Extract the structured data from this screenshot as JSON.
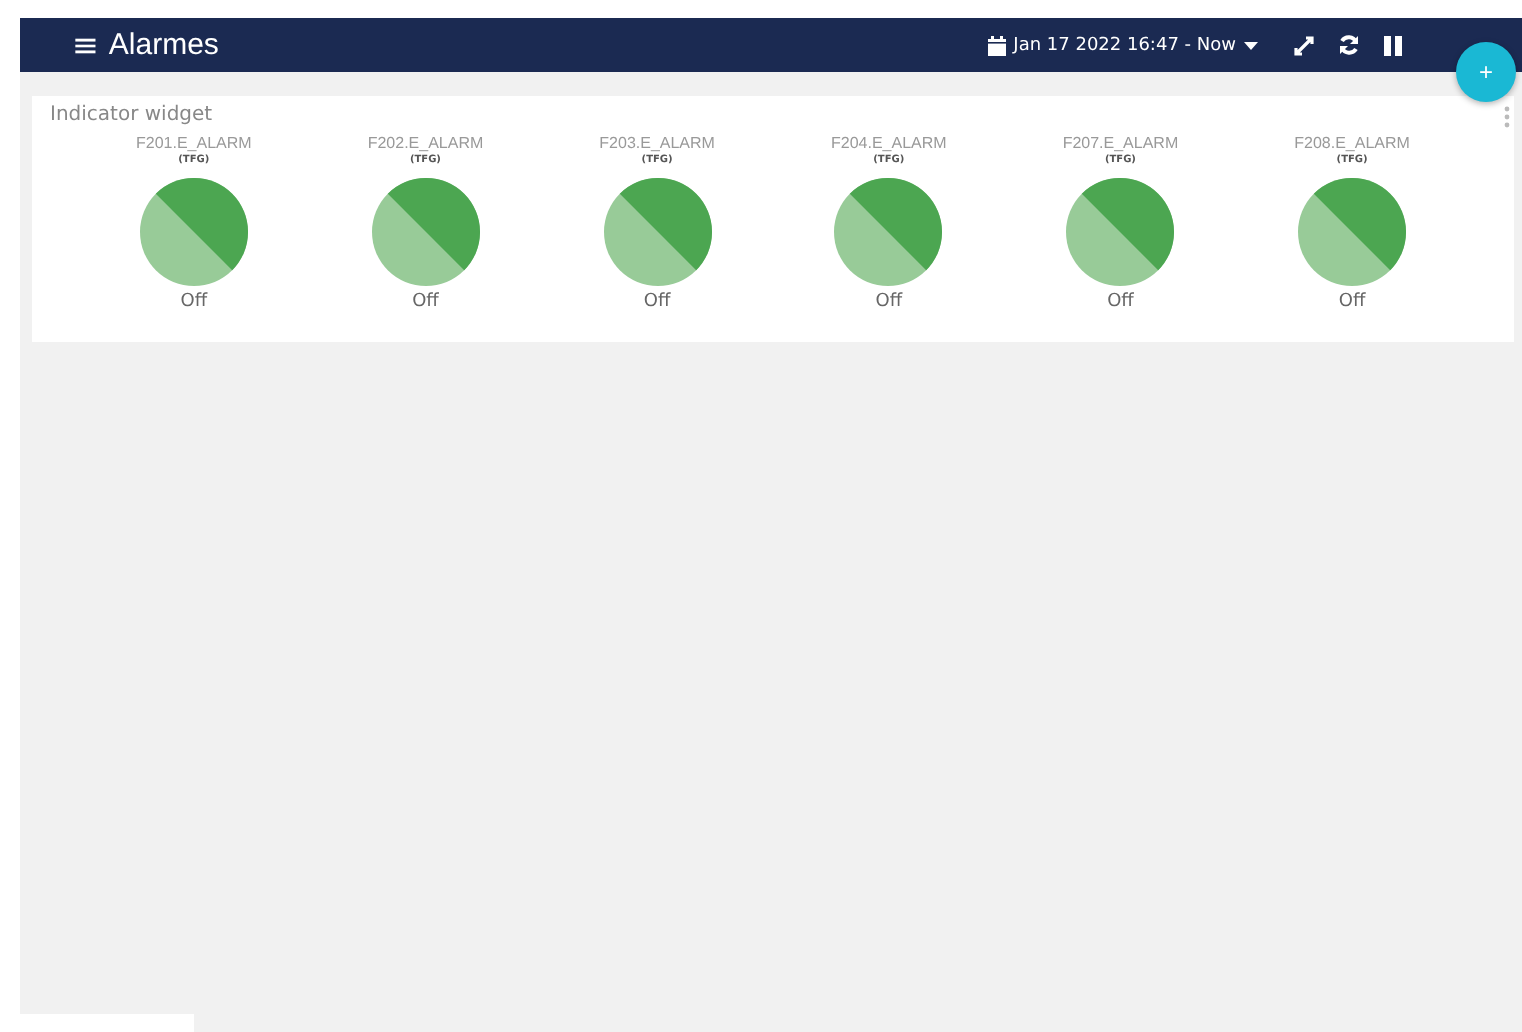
{
  "header": {
    "menu_glyph": "≡",
    "title": "Alarmes",
    "date_range": "Jan 17 2022 16:47 - Now"
  },
  "fab": {
    "label": "+"
  },
  "widget": {
    "title": "Indicator widget",
    "indicators": [
      {
        "name": "F201.E_ALARM",
        "tag": "(TFG)",
        "on": false,
        "status": "Off"
      },
      {
        "name": "F202.E_ALARM",
        "tag": "(TFG)",
        "on": false,
        "status": "Off"
      },
      {
        "name": "F203.E_ALARM",
        "tag": "(TFG)",
        "on": false,
        "status": "Off"
      },
      {
        "name": "F204.E_ALARM",
        "tag": "(TFG)",
        "on": false,
        "status": "Off"
      },
      {
        "name": "F207.E_ALARM",
        "tag": "(TFG)",
        "on": false,
        "status": "Off"
      },
      {
        "name": "F208.E_ALARM",
        "tag": "(TFG)",
        "on": false,
        "status": "Off"
      }
    ]
  }
}
